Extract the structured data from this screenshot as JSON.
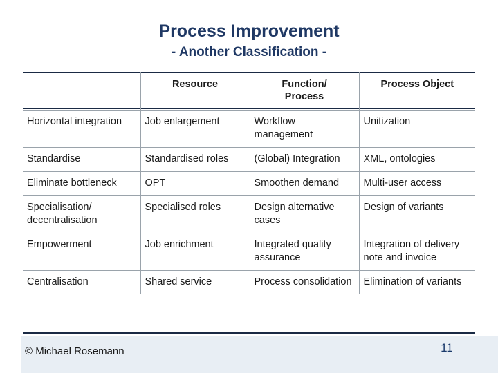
{
  "slide": {
    "title_main": "Process Improvement",
    "title_sub": "- Another Classification -",
    "copyright": "© Michael Rosemann",
    "page_number": "11",
    "accent_color": "#1f3864",
    "rule_color": "#1a2a44",
    "footer_band_color": "#e8eef4"
  },
  "table": {
    "headers": [
      "",
      "Resource",
      "Function/ Process",
      "Process Object"
    ],
    "header_corner": "",
    "header_resource": "Resource",
    "header_function": "Function/\nProcess",
    "header_function_line1": "Function/",
    "header_function_line2": "Process",
    "header_object": "Process Object",
    "rows": [
      {
        "label": "Horizontal integration",
        "resource": "Job enlargement",
        "function": "Workflow management",
        "object": "Unitization"
      },
      {
        "label": "Standardise",
        "resource": "Standardised roles",
        "function": "(Global) Integration",
        "object": "XML, ontologies"
      },
      {
        "label": "Eliminate bottleneck",
        "resource": "OPT",
        "function": "Smoothen demand",
        "object": "Multi-user access"
      },
      {
        "label": "Specialisation/ decentralisation",
        "resource": "Specialised roles",
        "function": "Design alternative cases",
        "object": "Design of variants"
      },
      {
        "label": "Empowerment",
        "resource": "Job enrichment",
        "function": "Integrated quality assurance",
        "object": "Integration of delivery note and invoice"
      },
      {
        "label": "Centralisation",
        "resource": "Shared service",
        "function": "Process consolidation",
        "object": "Elimination of variants"
      }
    ]
  }
}
